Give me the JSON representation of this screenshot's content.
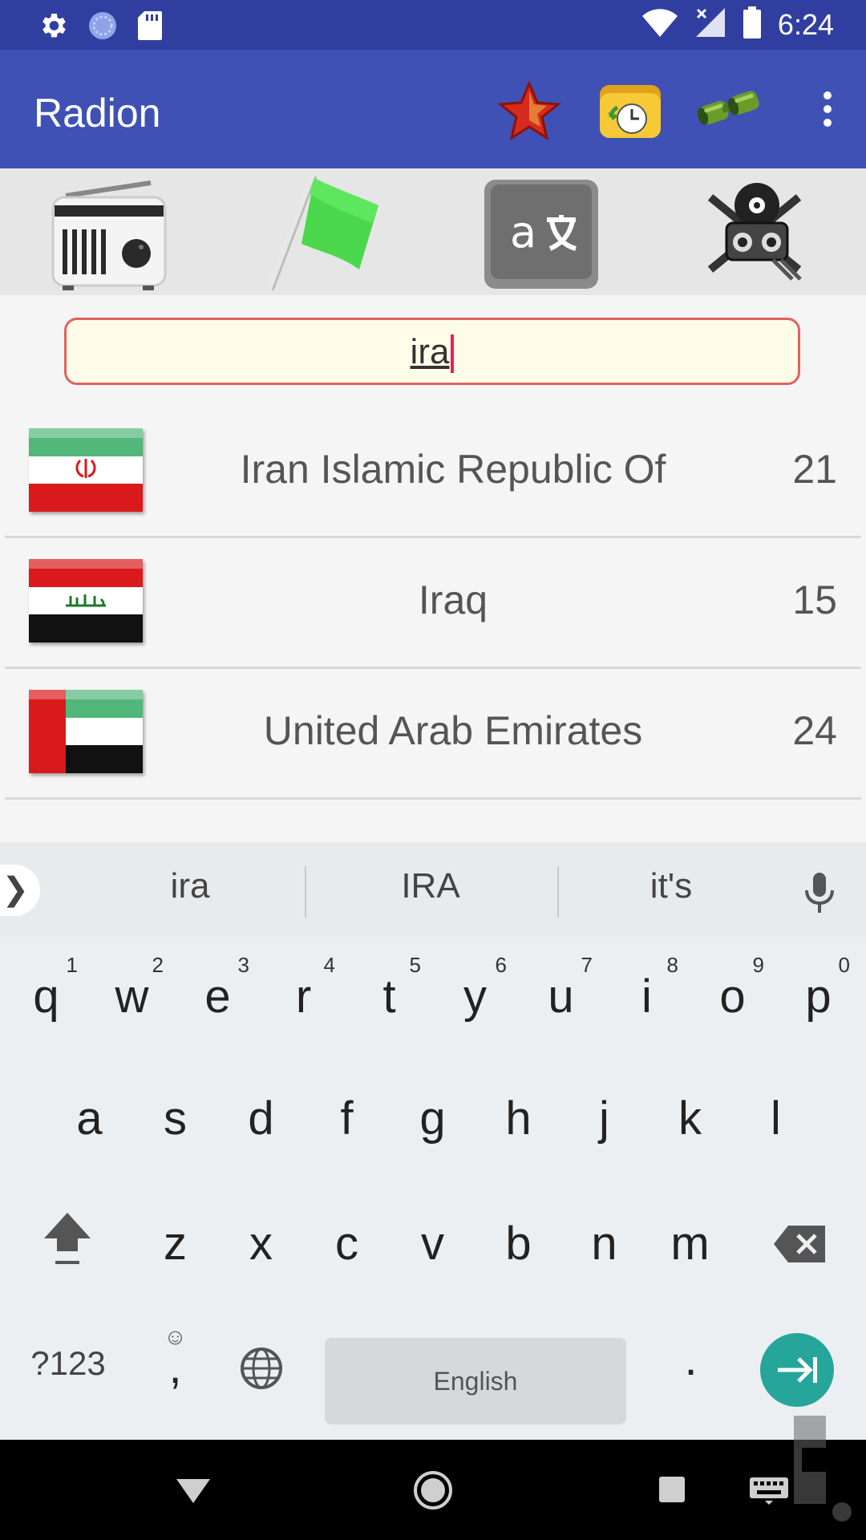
{
  "status_bar": {
    "time": "6:24"
  },
  "app_bar": {
    "title": "Radion"
  },
  "search": {
    "value": "ira"
  },
  "countries": [
    {
      "name": "Iran Islamic Republic Of",
      "count": "21"
    },
    {
      "name": "Iraq",
      "count": "15"
    },
    {
      "name": "United Arab Emirates",
      "count": "24"
    }
  ],
  "keyboard": {
    "suggestions": [
      "ira",
      "IRA",
      "it's"
    ],
    "row1": [
      "q",
      "w",
      "e",
      "r",
      "t",
      "y",
      "u",
      "i",
      "o",
      "p"
    ],
    "row1_hints": [
      "1",
      "2",
      "3",
      "4",
      "5",
      "6",
      "7",
      "8",
      "9",
      "0"
    ],
    "row2": [
      "a",
      "s",
      "d",
      "f",
      "g",
      "h",
      "j",
      "k",
      "l"
    ],
    "row3": [
      "z",
      "x",
      "c",
      "v",
      "b",
      "n",
      "m"
    ],
    "symbols_label": "?123",
    "comma_label": ",",
    "space_label": "English",
    "period_label": "."
  }
}
